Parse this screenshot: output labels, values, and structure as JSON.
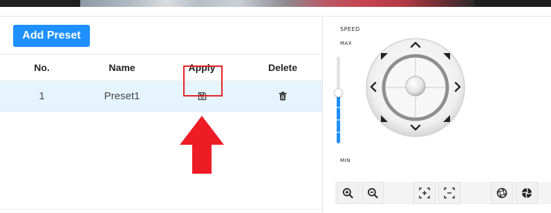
{
  "toolbar": {
    "add_preset_label": "Add Preset"
  },
  "table": {
    "columns": [
      "No.",
      "Name",
      "Apply",
      "Delete"
    ],
    "rows": [
      {
        "no": "1",
        "name": "Preset1"
      }
    ]
  },
  "ptz": {
    "speed_label": "SPEED",
    "max_label": "MAX",
    "min_label": "MIN",
    "speed_level_fraction": 0.55
  },
  "colors": {
    "accent": "#1e90ff",
    "highlight": "#e31e24",
    "selected_row": "#e6f4fd"
  },
  "icons": {
    "apply": "save-icon",
    "delete": "trash-icon",
    "zoom_in": "zoom-in-icon",
    "zoom_out": "zoom-out-icon",
    "focus_near": "focus-near-icon",
    "focus_far": "focus-far-icon",
    "iris_open": "iris-open-icon",
    "iris_close": "iris-close-icon"
  }
}
